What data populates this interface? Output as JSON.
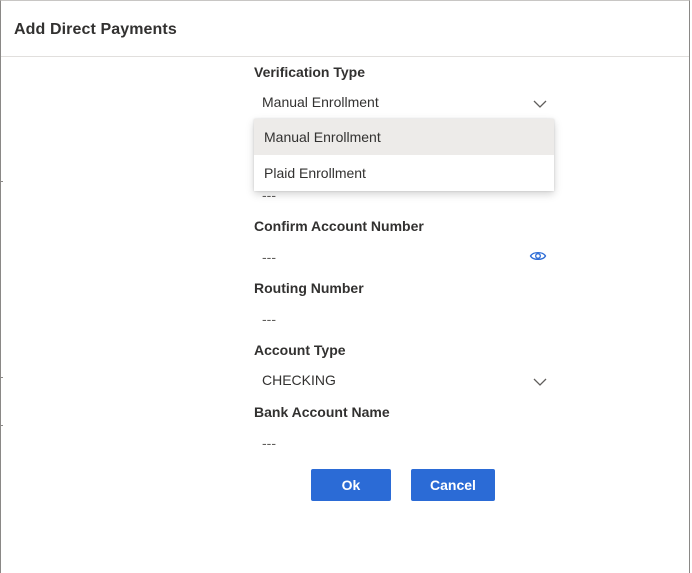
{
  "dialog": {
    "title": "Add Direct Payments"
  },
  "form": {
    "verification_type": {
      "label": "Verification Type",
      "value": "Manual Enrollment",
      "options": [
        "Manual Enrollment",
        "Plaid Enrollment"
      ],
      "selected_option": "Manual Enrollment"
    },
    "account_number": {
      "value": "---"
    },
    "confirm_account_number": {
      "label": "Confirm Account Number",
      "value": "---",
      "icon": "eye-icon"
    },
    "routing_number": {
      "label": "Routing Number",
      "value": "---"
    },
    "account_type": {
      "label": "Account Type",
      "value": "CHECKING"
    },
    "bank_account_name": {
      "label": "Bank Account Name",
      "value": "---"
    }
  },
  "buttons": {
    "ok_label": "Ok",
    "cancel_label": "Cancel"
  },
  "colors": {
    "primary": "#2b6bd6",
    "icon_accent": "#2b6bd6",
    "selected_option_bg": "#edebe9"
  }
}
